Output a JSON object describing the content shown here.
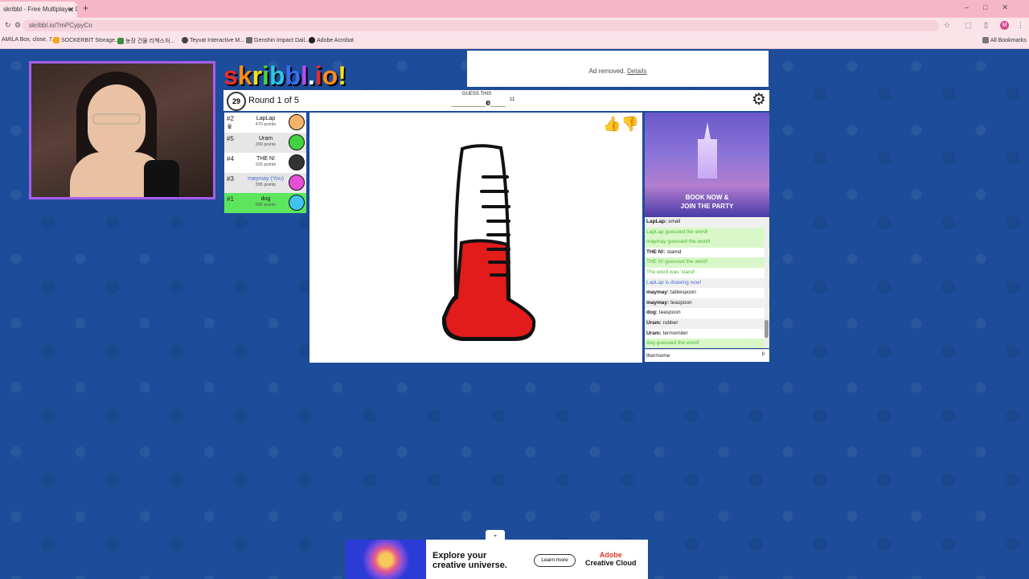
{
  "browser": {
    "tab_title": "skribbl - Free Multiplayer D",
    "tab_close": "✕",
    "new_tab": "+",
    "url": "skribbl.io/?mPCypyCo",
    "bookmarks": [
      "AMILA Box, close, 7...",
      "SOCKERBIT Storage...",
      "농장 건물 리책스처...",
      "Teyvat Interactive M...",
      "Genshin Impact Dail...",
      "Adobe Acrobat"
    ],
    "all_bookmarks": "All Bookmarks",
    "profile_initial": "M"
  },
  "logo": {
    "letters": [
      "s",
      "k",
      "r",
      "i",
      "b",
      "b",
      "l",
      ".",
      "i",
      "o",
      "!"
    ],
    "colors": [
      "#ef2a2a",
      "#ff8c1a",
      "#f5e31a",
      "#4fd23b",
      "#2ec6e6",
      "#3b6df0",
      "#b44cf0",
      "#ffffff",
      "#ef2a2a",
      "#ff8c1a",
      "#f5e31a"
    ]
  },
  "ad_removed": {
    "text": "Ad removed.",
    "link": "Details"
  },
  "game": {
    "timer": "29",
    "round": "Round 1 of 5",
    "guess_label": "GUESS THIS",
    "word_hint": "_______e___",
    "word_length": "11"
  },
  "players": [
    {
      "rank": "#2",
      "name": "LapLap",
      "points": "470 points",
      "style": "odd",
      "avatar_color": "#f4b26b",
      "crown": true
    },
    {
      "rank": "#5",
      "name": "Uram",
      "points": "290 points",
      "style": "even",
      "avatar_color": "#3fd43f",
      "crown": false
    },
    {
      "rank": "#4",
      "name": "THE N!",
      "points": "325 points",
      "style": "odd",
      "avatar_color": "#333333",
      "crown": false
    },
    {
      "rank": "#3",
      "name": "maymay (You)",
      "points": "395 points",
      "style": "even",
      "avatar_color": "#e84fd6",
      "crown": false
    },
    {
      "rank": "#1",
      "name": "dog",
      "points": "665 points",
      "style": "win",
      "avatar_color": "#3fc3f0",
      "crown": false
    }
  ],
  "side_ad": {
    "line1": "BOOK NOW &",
    "line2": "JOIN THE PARTY"
  },
  "chat": [
    {
      "user": "LapLap:",
      "text": "small",
      "kind": "a"
    },
    {
      "user": "",
      "text": "LapLap guessed the word!",
      "kind": "g"
    },
    {
      "user": "",
      "text": "maymay guessed the word!",
      "kind": "g"
    },
    {
      "user": "THE N!:",
      "text": "stamd",
      "kind": "n"
    },
    {
      "user": "",
      "text": "THE N! guessed the word!",
      "kind": "g"
    },
    {
      "user": "",
      "text": "The word was 'stand'",
      "kind": "g2"
    },
    {
      "user": "",
      "text": "LapLap is drawing now!",
      "kind": "blue"
    },
    {
      "user": "maymay:",
      "text": "tablespoon",
      "kind": "n"
    },
    {
      "user": "maymay:",
      "text": "teaspoon",
      "kind": "a"
    },
    {
      "user": "dog:",
      "text": "teaspoon",
      "kind": "n"
    },
    {
      "user": "Uram:",
      "text": "rubber",
      "kind": "a"
    },
    {
      "user": "Uram:",
      "text": "termomiter",
      "kind": "n"
    },
    {
      "user": "",
      "text": "dog guessed the word!",
      "kind": "g"
    }
  ],
  "chat_input": {
    "value": "thermome",
    "count": "8"
  },
  "bottom_ad": {
    "line1": "Explore your",
    "line2": "creative universe.",
    "button": "Learn more",
    "brand1": "Adobe",
    "brand2": "Creative Cloud"
  },
  "chevron": "⌄"
}
